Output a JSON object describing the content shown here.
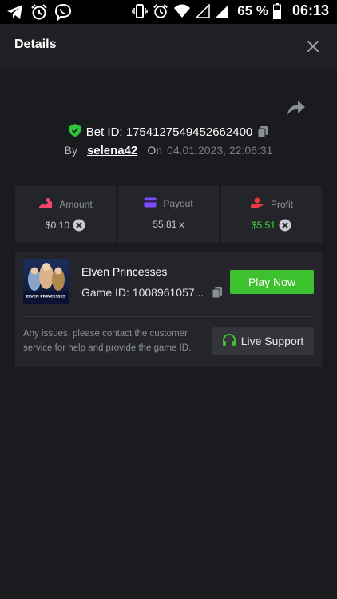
{
  "status_bar": {
    "battery_percent": "65 %",
    "time": "06:13",
    "left_icons": [
      "telegram-icon",
      "alarm-icon",
      "viber-icon"
    ],
    "right_icons": [
      "vibrate-icon",
      "alarm-icon",
      "wifi-icon",
      "signal-icon",
      "signal-icon",
      "battery-icon"
    ]
  },
  "header": {
    "title": "Details",
    "close_icon": "close-icon"
  },
  "bet": {
    "id_label": "Bet ID: 1754127549452662400",
    "by_label": "By",
    "username": "selena42",
    "on_label": "On",
    "date": "04.01.2023, 22:06:31"
  },
  "stats": {
    "amount": {
      "label": "Amount",
      "value": "$0.10",
      "icon": "amount-icon"
    },
    "payout": {
      "label": "Payout",
      "value": "55.81 x",
      "icon": "wallet-icon"
    },
    "profit": {
      "label": "Profit",
      "value": "$5.51",
      "icon": "profit-icon"
    }
  },
  "game": {
    "name": "Elven Princesses",
    "id_label": "Game ID: 1008961057...",
    "thumb_text": "ELVEN PRINCESSES",
    "play_label": "Play Now",
    "support_text": "Any issues, please contact the customer service for help and provide the game ID.",
    "support_label": "Live Support"
  },
  "colors": {
    "accent_green": "#3ec12e",
    "profit_green": "#3fd63a",
    "amount_pink": "#f0466e",
    "payout_purple": "#7b4dff",
    "profit_red": "#e93b3b"
  }
}
